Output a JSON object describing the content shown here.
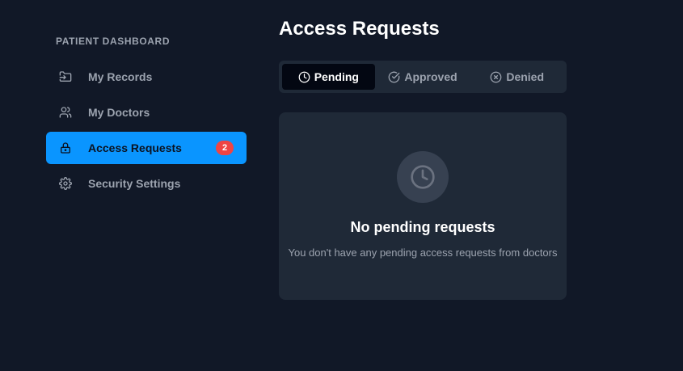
{
  "sidebar": {
    "heading": "PATIENT DASHBOARD",
    "items": [
      {
        "label": "My Records",
        "icon": "folder-input-icon",
        "active": false
      },
      {
        "label": "My Doctors",
        "icon": "users-icon",
        "active": false
      },
      {
        "label": "Access Requests",
        "icon": "lock-icon",
        "active": true,
        "badge": "2"
      },
      {
        "label": "Security Settings",
        "icon": "gear-icon",
        "active": false
      }
    ]
  },
  "main": {
    "title": "Access Requests",
    "tabs": [
      {
        "label": "Pending",
        "icon": "clock-icon",
        "active": true
      },
      {
        "label": "Approved",
        "icon": "check-circle-icon",
        "active": false
      },
      {
        "label": "Denied",
        "icon": "x-circle-icon",
        "active": false
      }
    ],
    "empty_state": {
      "icon": "clock-icon",
      "title": "No pending requests",
      "message": "You don't have any pending access requests from doctors"
    }
  },
  "colors": {
    "background": "#111827",
    "card": "#1f2937",
    "accent": "#0a95ff",
    "badge": "#ef4444"
  }
}
